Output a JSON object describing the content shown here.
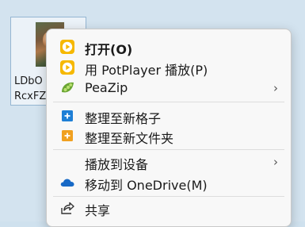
{
  "desktop_file": {
    "name_line1": "LDbO",
    "name_line2": "RcxFZ"
  },
  "context_menu": {
    "items": [
      {
        "label": "打开(O)",
        "icon": "play-circle-icon"
      },
      {
        "label": "用 PotPlayer 播放(P)",
        "icon": "play-circle-icon"
      },
      {
        "label": "PeaZip",
        "icon": "peazip-icon",
        "submenu": "›"
      },
      {
        "label": "整理至新格子",
        "icon": "plus-box-icon"
      },
      {
        "label": "整理至新文件夹",
        "icon": "plus-folder-icon"
      },
      {
        "label": "播放到设备",
        "icon": "",
        "submenu": "›"
      },
      {
        "label": "移动到 OneDrive(M)",
        "icon": "onedrive-icon"
      },
      {
        "label": "共享",
        "icon": "share-icon"
      }
    ]
  },
  "colors": {
    "potplayer_yellow": "#f6b800",
    "fences_blue": "#1e7fd6",
    "fences_orange": "#f0a020",
    "onedrive_blue": "#1769c6",
    "peazip_green": "#8cc63f"
  }
}
